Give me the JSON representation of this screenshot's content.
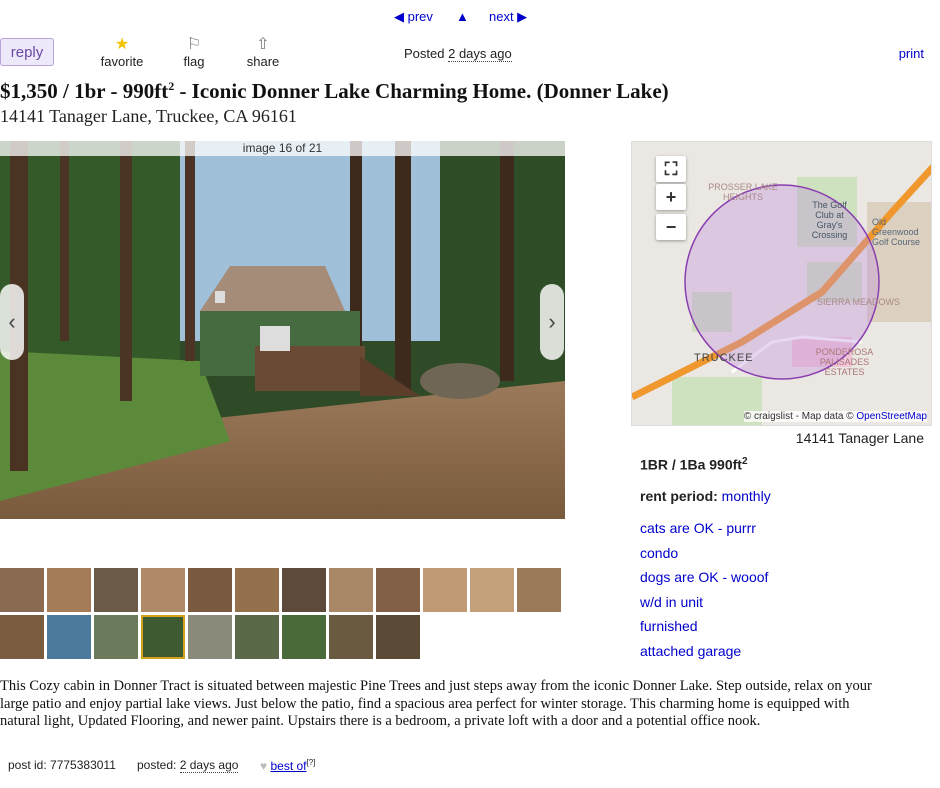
{
  "nav": {
    "prev": "◀ prev",
    "up": "▲",
    "next": "next ▶"
  },
  "actions": {
    "reply": "reply",
    "favorite": "favorite",
    "flag": "flag",
    "share": "share",
    "posted_label": "Posted",
    "posted_value": "2 days ago",
    "print": "print"
  },
  "listing": {
    "title_main": "$1,350 / 1br - 990ft",
    "title_sup": "2",
    "title_rest": " - Iconic Donner Lake Charming Home. (Donner Lake)",
    "address": "14141 Tanager Lane, Truckee, CA 96161"
  },
  "gallery": {
    "counter": "image 16 of 21",
    "prev_arrow": "‹",
    "next_arrow": "›",
    "thumb_count": 21,
    "selected_thumb": 16
  },
  "map": {
    "labels": {
      "prosser": "PROSSER LAKE HEIGHTS",
      "golf": "The Golf Club at Gray's Crossing",
      "old_greenwood": "Old Greenwood Golf Course",
      "truckee": "TRUCKEE",
      "sierra": "SIERRA MEADOWS",
      "ponderosa": "PONDEROSA PALISADES ESTATES"
    },
    "attribution": "© craigslist - Map data ©",
    "osm": "OpenStreetMap",
    "address": "14141 Tanager Lane"
  },
  "attributes": {
    "beds_baths": "1BR / 1Ba 990ft",
    "beds_sup": "2",
    "rent_label": "rent period:",
    "rent_value": "monthly",
    "items": [
      "cats are OK - purrr",
      "condo",
      "dogs are OK - wooof",
      "w/d in unit",
      "furnished",
      "attached garage"
    ]
  },
  "description": {
    "line1": "This Cozy cabin in Donner Tract is situated between majestic Pine Trees and just steps away from the iconic Donner Lake. Step outside, relax on your",
    "line2": "large patio and enjoy partial lake views. Just below the patio, find a spacious area perfect for winter storage. This charming home is equipped with",
    "line3": "natural light, Updated Flooring, and newer paint. Upstairs there is a bedroom, a private loft with a door and a potential office nook."
  },
  "footer": {
    "post_id": "post id: 7775383011",
    "posted_label": "posted:",
    "posted_value": "2 days ago",
    "best_of": "best of",
    "best_of_sup": "[?]"
  },
  "colors": {
    "link": "#0000cc",
    "reply_bg": "#eee8fb",
    "route": "#f0982e",
    "radius": "#8a3fb0"
  }
}
